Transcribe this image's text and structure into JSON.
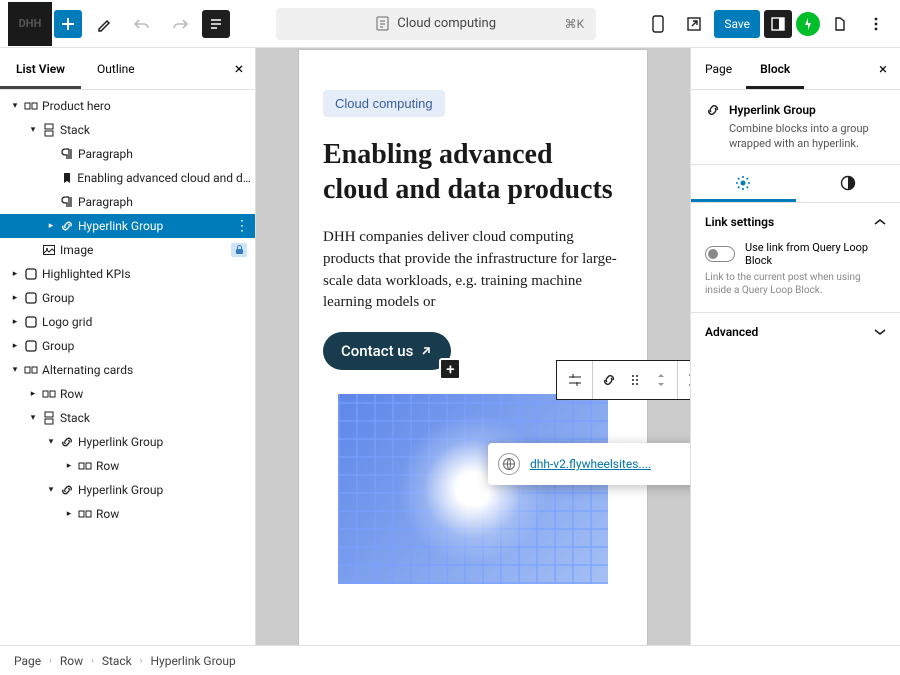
{
  "topbar": {
    "doc_title": "Cloud computing",
    "shortcut": "⌘K",
    "save_label": "Save"
  },
  "left_panel": {
    "tabs": {
      "list_view": "List View",
      "outline": "Outline"
    },
    "tree": [
      {
        "depth": 0,
        "caret": "down",
        "icon": "row",
        "label": "Product hero"
      },
      {
        "depth": 1,
        "caret": "down",
        "icon": "stack",
        "label": "Stack"
      },
      {
        "depth": 2,
        "caret": "",
        "icon": "paragraph",
        "label": "Paragraph"
      },
      {
        "depth": 2,
        "caret": "",
        "icon": "bookmark",
        "label": "Enabling advanced cloud and da..."
      },
      {
        "depth": 2,
        "caret": "",
        "icon": "paragraph",
        "label": "Paragraph"
      },
      {
        "depth": 2,
        "caret": "right",
        "icon": "link",
        "label": "Hyperlink Group",
        "selected": true
      },
      {
        "depth": 1,
        "caret": "",
        "icon": "image",
        "label": "Image",
        "locked": true
      },
      {
        "depth": 0,
        "caret": "right",
        "icon": "group",
        "label": "Highlighted KPIs"
      },
      {
        "depth": 0,
        "caret": "right",
        "icon": "group",
        "label": "Group"
      },
      {
        "depth": 0,
        "caret": "right",
        "icon": "group",
        "label": "Logo grid"
      },
      {
        "depth": 0,
        "caret": "right",
        "icon": "group",
        "label": "Group"
      },
      {
        "depth": 0,
        "caret": "down",
        "icon": "row",
        "label": "Alternating cards"
      },
      {
        "depth": 1,
        "caret": "right",
        "icon": "row",
        "label": "Row"
      },
      {
        "depth": 1,
        "caret": "down",
        "icon": "stack",
        "label": "Stack"
      },
      {
        "depth": 2,
        "caret": "down",
        "icon": "link",
        "label": "Hyperlink Group"
      },
      {
        "depth": 3,
        "caret": "right",
        "icon": "row",
        "label": "Row"
      },
      {
        "depth": 2,
        "caret": "down",
        "icon": "link",
        "label": "Hyperlink Group"
      },
      {
        "depth": 3,
        "caret": "right",
        "icon": "row",
        "label": "Row"
      }
    ]
  },
  "canvas": {
    "badge": "Cloud computing",
    "heading": "Enabling advanced cloud and data products",
    "paragraph": "DHH companies deliver cloud computing products that provide the infrastructure for large-scale data workloads, e.g. training machine learning models or",
    "cta": "Contact us"
  },
  "link_popover": {
    "url": "dhh-v2.flywheelsites...."
  },
  "right_panel": {
    "tabs": {
      "page": "Page",
      "block": "Block"
    },
    "block_name": "Hyperlink Group",
    "block_desc": "Combine blocks into a group wrapped with an hyperlink.",
    "link_settings_title": "Link settings",
    "toggle_label": "Use link from Query Loop Block",
    "toggle_hint": "Link to the current post when using inside a Query Loop Block.",
    "advanced_title": "Advanced"
  },
  "breadcrumb": [
    "Page",
    "Row",
    "Stack",
    "Hyperlink Group"
  ]
}
